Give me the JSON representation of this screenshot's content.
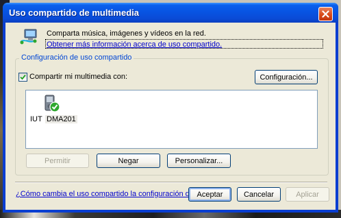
{
  "window": {
    "title": "Uso compartido de multimedia",
    "close_icon": "close-icon"
  },
  "info": {
    "icon": "network-share-icon",
    "text": "Comparta música, imágenes y vídeos en la red.",
    "link": "Obtener más información acerca de uso compartido."
  },
  "group": {
    "title": "Configuración de uso compartido",
    "share_checkbox": {
      "label": "Compartir mi multimedia con:",
      "checked": true
    },
    "settings_button": "Configuración..."
  },
  "devices": [
    {
      "icon": "media-device-allowed-icon",
      "label_prefix": "IUT",
      "label_name": "DMA201"
    }
  ],
  "device_actions": {
    "allow": "Permitir",
    "deny": "Negar",
    "customize": "Personalizar..."
  },
  "footer": {
    "firewall_link": "¿Cómo cambia el uso compartido la configuración del firewall?",
    "ok": "Aceptar",
    "cancel": "Cancelar",
    "apply": "Aplicar"
  },
  "colors": {
    "titlebar": "#0854e3",
    "dialog_bg": "#ece9d8",
    "group_title": "#0046d5",
    "link": "#0000cc",
    "close_button": "#d84a1a",
    "status_ok": "#2fa82f"
  }
}
